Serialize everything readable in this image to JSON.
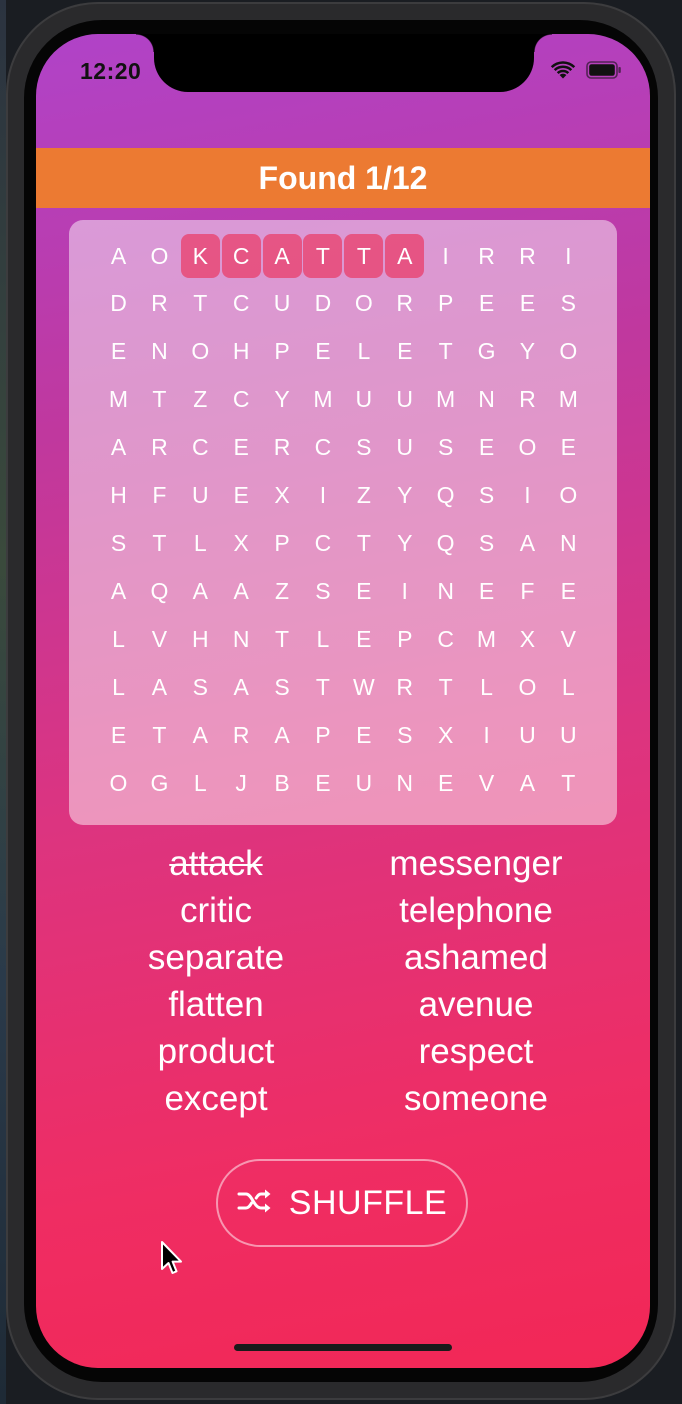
{
  "status_bar": {
    "time": "12:20",
    "icons": [
      "wifi-icon",
      "battery-icon"
    ]
  },
  "header": {
    "title": "Found 1/12",
    "color": "#ec7a32"
  },
  "grid": {
    "rows": [
      [
        "A",
        "O",
        "K",
        "C",
        "A",
        "T",
        "T",
        "A",
        "I",
        "R",
        "R",
        "I"
      ],
      [
        "D",
        "R",
        "T",
        "C",
        "U",
        "D",
        "O",
        "R",
        "P",
        "E",
        "E",
        "S"
      ],
      [
        "E",
        "N",
        "O",
        "H",
        "P",
        "E",
        "L",
        "E",
        "T",
        "G",
        "Y",
        "O"
      ],
      [
        "M",
        "T",
        "Z",
        "C",
        "Y",
        "M",
        "U",
        "U",
        "M",
        "N",
        "R",
        "M"
      ],
      [
        "A",
        "R",
        "C",
        "E",
        "R",
        "C",
        "S",
        "U",
        "S",
        "E",
        "O",
        "E"
      ],
      [
        "H",
        "F",
        "U",
        "E",
        "X",
        "I",
        "Z",
        "Y",
        "Q",
        "S",
        "I",
        "O"
      ],
      [
        "S",
        "T",
        "L",
        "X",
        "P",
        "C",
        "T",
        "Y",
        "Q",
        "S",
        "A",
        "N"
      ],
      [
        "A",
        "Q",
        "A",
        "A",
        "Z",
        "S",
        "E",
        "I",
        "N",
        "E",
        "F",
        "E"
      ],
      [
        "L",
        "V",
        "H",
        "N",
        "T",
        "L",
        "E",
        "P",
        "C",
        "M",
        "X",
        "V"
      ],
      [
        "L",
        "A",
        "S",
        "A",
        "S",
        "T",
        "W",
        "R",
        "T",
        "L",
        "O",
        "L"
      ],
      [
        "E",
        "T",
        "A",
        "R",
        "A",
        "P",
        "E",
        "S",
        "X",
        "I",
        "U",
        "U"
      ],
      [
        "O",
        "G",
        "L",
        "J",
        "B",
        "E",
        "U",
        "N",
        "E",
        "V",
        "A",
        "T"
      ]
    ],
    "highlighted": [
      [
        0,
        2
      ],
      [
        0,
        3
      ],
      [
        0,
        4
      ],
      [
        0,
        5
      ],
      [
        0,
        6
      ],
      [
        0,
        7
      ]
    ],
    "highlight_color": "#e84673"
  },
  "words": {
    "left": [
      {
        "text": "attack",
        "found": true
      },
      {
        "text": "critic",
        "found": false
      },
      {
        "text": "separate",
        "found": false
      },
      {
        "text": "flatten",
        "found": false
      },
      {
        "text": "product",
        "found": false
      },
      {
        "text": "except",
        "found": false
      }
    ],
    "right": [
      {
        "text": "messenger",
        "found": false
      },
      {
        "text": "telephone",
        "found": false
      },
      {
        "text": "ashamed",
        "found": false
      },
      {
        "text": "avenue",
        "found": false
      },
      {
        "text": "respect",
        "found": false
      },
      {
        "text": "someone",
        "found": false
      }
    ]
  },
  "shuffle_button": {
    "label": "SHUFFLE",
    "icon": "shuffle-icon"
  }
}
